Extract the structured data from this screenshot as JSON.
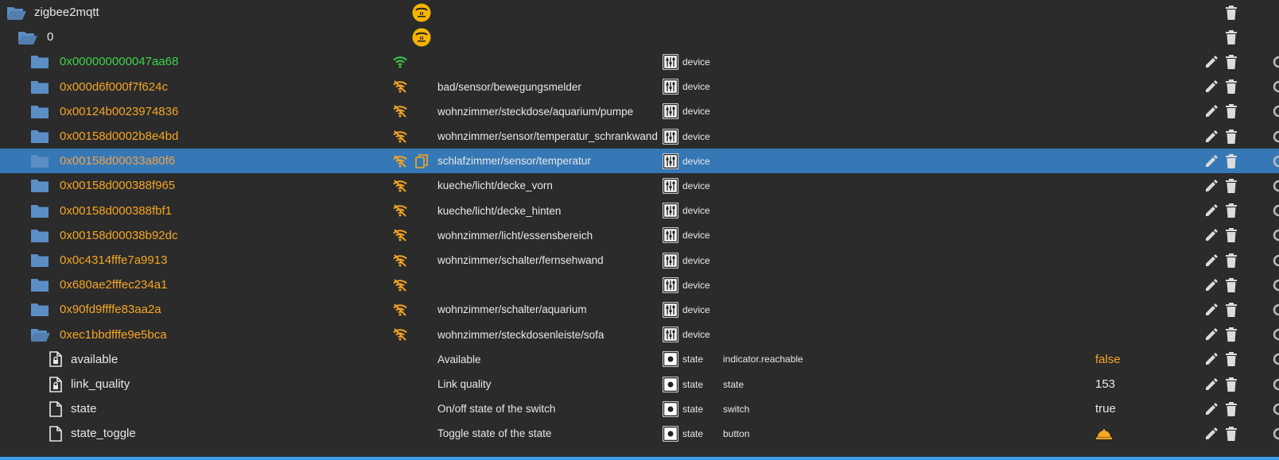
{
  "tree": {
    "root": {
      "name": "zigbee2mqtt",
      "icon": "folder-open-icon",
      "badge_icon": "mqtt-adapter-icon"
    },
    "instance": {
      "name": "0",
      "icon": "folder-open-icon",
      "badge_icon": "mqtt-adapter-icon"
    },
    "devices": [
      {
        "id": "0x000000000047aa68",
        "color": "#3fd34a",
        "signal": "wifi-icon",
        "signal_color": "#3fd34a",
        "description": "",
        "role": "device"
      },
      {
        "id": "0x000d6f000f7f624c",
        "color": "#f5a623",
        "signal": "wifi-off-icon",
        "signal_color": "#f5a623",
        "description": "bad/sensor/bewegungsmelder",
        "role": "device"
      },
      {
        "id": "0x00124b0023974836",
        "color": "#f5a623",
        "signal": "wifi-off-icon",
        "signal_color": "#f5a623",
        "description": "wohnzimmer/steckdose/aquarium/pumpe",
        "role": "device"
      },
      {
        "id": "0x00158d0002b8e4bd",
        "color": "#f5a623",
        "signal": "wifi-off-icon",
        "signal_color": "#f5a623",
        "description": "wohnzimmer/sensor/temperatur_schrankwand",
        "role": "device"
      },
      {
        "id": "0x00158d00033a80f6",
        "color": "#f0a04b",
        "signal": "wifi-off-icon",
        "signal_color": "#f5a623",
        "description": "schlafzimmer/sensor/temperatur",
        "role": "device",
        "selected": true
      },
      {
        "id": "0x00158d000388f965",
        "color": "#f5a623",
        "signal": "wifi-off-icon",
        "signal_color": "#f5a623",
        "description": "kueche/licht/decke_vorn",
        "role": "device"
      },
      {
        "id": "0x00158d000388fbf1",
        "color": "#f5a623",
        "signal": "wifi-off-icon",
        "signal_color": "#f5a623",
        "description": "kueche/licht/decke_hinten",
        "role": "device"
      },
      {
        "id": "0x00158d00038b92dc",
        "color": "#f5a623",
        "signal": "wifi-off-icon",
        "signal_color": "#f5a623",
        "description": "wohnzimmer/licht/essensbereich",
        "role": "device"
      },
      {
        "id": "0x0c4314fffe7a9913",
        "color": "#f5a623",
        "signal": "wifi-off-icon",
        "signal_color": "#f5a623",
        "description": "wohnzimmer/schalter/fernsehwand",
        "role": "device"
      },
      {
        "id": "0x680ae2fffec234a1",
        "color": "#f5a623",
        "signal": "wifi-off-icon",
        "signal_color": "#f5a623",
        "description": "",
        "role": "device"
      },
      {
        "id": "0x90fd9ffffe83aa2a",
        "color": "#f5a623",
        "signal": "wifi-off-icon",
        "signal_color": "#f5a623",
        "description": "wohnzimmer/schalter/aquarium",
        "role": "device"
      },
      {
        "id": "0xec1bbdfffe9e5bca",
        "color": "#f5a623",
        "signal": "wifi-off-icon",
        "signal_color": "#f5a623",
        "description": "wohnzimmer/steckdosenleiste/sofa",
        "role": "device",
        "expanded": true
      }
    ],
    "states": [
      {
        "name": "available",
        "icon": "file-lock-icon",
        "description": "Available",
        "type": "state",
        "role": "indicator.reachable",
        "value": "false",
        "value_color": "#f5a623"
      },
      {
        "name": "link_quality",
        "icon": "file-lock-icon",
        "description": "Link quality",
        "type": "state",
        "role": "state",
        "value": "153",
        "value_color": "#e8e8e8"
      },
      {
        "name": "state",
        "icon": "file-icon",
        "description": "On/off state of the switch",
        "type": "state",
        "role": "switch",
        "value": "true",
        "value_color": "#e8e8e8"
      },
      {
        "name": "state_toggle",
        "icon": "file-icon",
        "description": "Toggle state of the state",
        "type": "state",
        "role": "button",
        "value": "",
        "value_icon": "bell-button-icon",
        "value_color": "#f5a623"
      }
    ]
  },
  "colors": {
    "background": "#2b2b2b",
    "selected_row": "#3578b5",
    "folder": "#5b8ec5",
    "accent_bottom": "#3d9ee9"
  }
}
